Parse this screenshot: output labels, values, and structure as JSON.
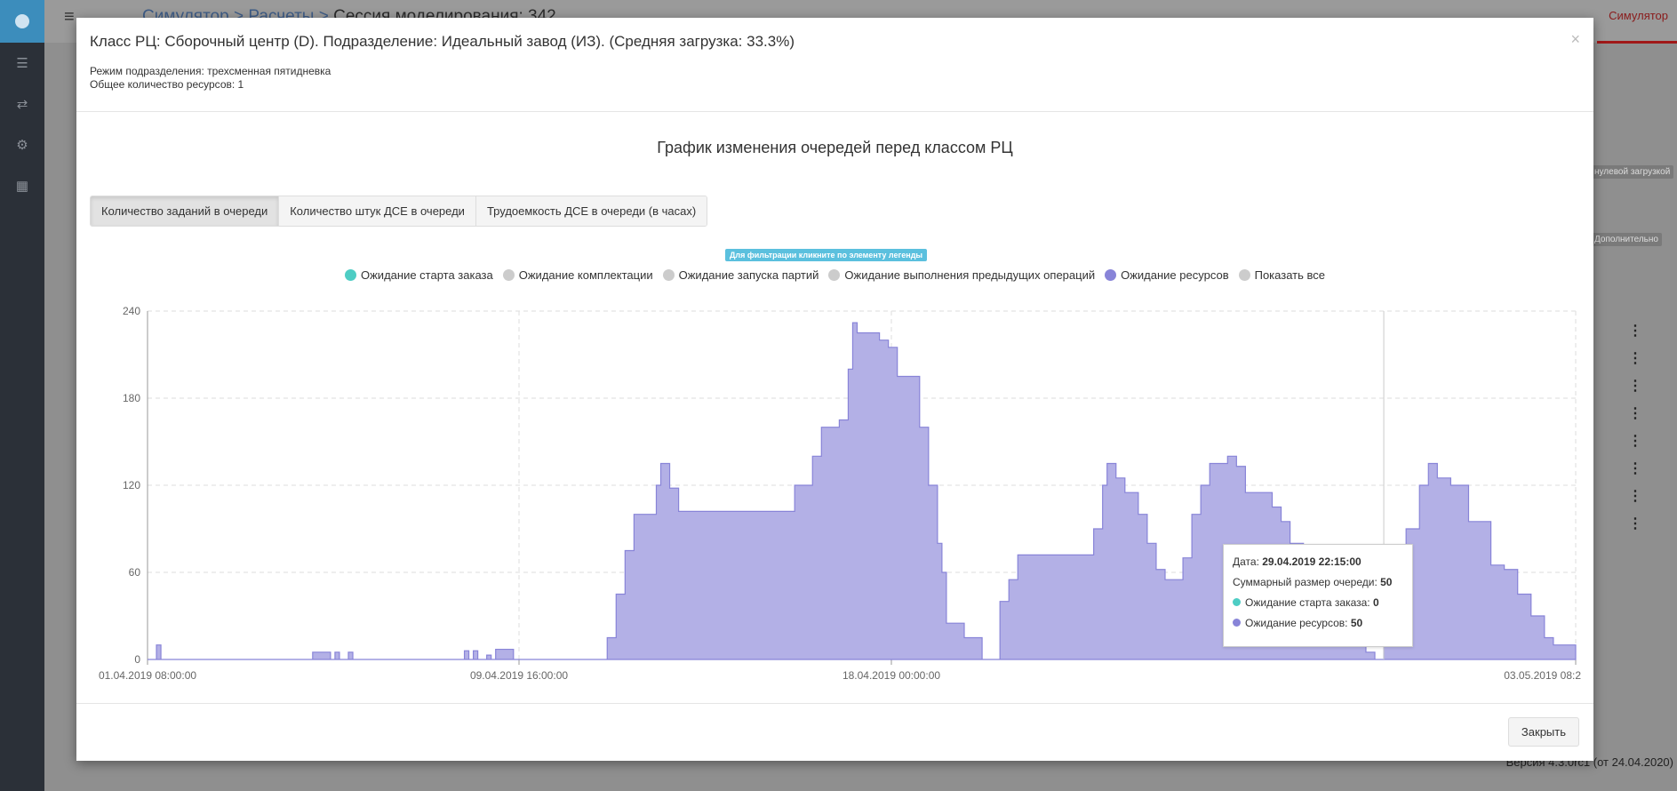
{
  "app": {
    "breadcrumb": [
      "Симулятор",
      "Расчеты"
    ],
    "breadcrumb_current": "Сессия моделирования: 342",
    "user_menu": "Симулятор",
    "version": "Версия 4.3.0rc1 (от 24.04.2020)",
    "side_buttons": [
      "Дополнительно",
      "нулевой загрузкой"
    ]
  },
  "modal": {
    "title": "Класс РЦ: Сборочный центр (D). Подразделение: Идеальный завод (ИЗ). (Средняя загрузка: 33.3%)",
    "mode_line": "Режим подразделения: трехсменная пятидневка",
    "resources_line": "Общее количество ресурсов: 1",
    "close_x": "×",
    "close_button": "Закрыть"
  },
  "tabs": [
    {
      "label": "Количество заданий в очереди",
      "active": true
    },
    {
      "label": "Количество штук ДСЕ в очереди",
      "active": false
    },
    {
      "label": "Трудоемкость ДСЕ в очереди (в часах)",
      "active": false
    }
  ],
  "hint": "Для фильтрации кликните по элементу легенды",
  "legend": [
    {
      "label": "Ожидание старта заказа",
      "color": "#4ecdc4",
      "active": true
    },
    {
      "label": "Ожидание комплектации",
      "color": "#cccccc",
      "active": false
    },
    {
      "label": "Ожидание запуска партий",
      "color": "#cccccc",
      "active": false
    },
    {
      "label": "Ожидание выполнения предыдущих операций",
      "color": "#cccccc",
      "active": false
    },
    {
      "label": "Ожидание ресурсов",
      "color": "#8884d8",
      "active": true
    },
    {
      "label": "Показать все",
      "color": "#cccccc",
      "active": false
    }
  ],
  "tooltip": {
    "date_label": "Дата:",
    "date_value": "29.04.2019 22:15:00",
    "total_label": "Суммарный размер очереди:",
    "total_value": "50",
    "s1_label": "Ожидание старта заказа:",
    "s1_value": "0",
    "s2_label": "Ожидание ресурсов:",
    "s2_value": "50"
  },
  "chart_data": {
    "type": "area",
    "title": "График изменения очередей перед классом РЦ",
    "x_tick_labels": [
      "01.04.2019 08:00:00",
      "09.04.2019 16:00:00",
      "18.04.2019 00:00:00",
      "03.05.2019 08:2"
    ],
    "x_domain_days": [
      0,
      32.0
    ],
    "ylim": [
      0,
      240
    ],
    "y_ticks": [
      0,
      60,
      120,
      180,
      240
    ],
    "grid": true,
    "fill_color": "#b3b0e6",
    "line_color": "#8884d8",
    "series": [
      {
        "name": "Ожидание ресурсов",
        "points": [
          [
            0.0,
            0
          ],
          [
            0.2,
            10
          ],
          [
            0.3,
            0
          ],
          [
            3.6,
            0
          ],
          [
            3.7,
            5
          ],
          [
            4.0,
            5
          ],
          [
            4.1,
            0
          ],
          [
            4.2,
            5
          ],
          [
            4.3,
            0
          ],
          [
            4.5,
            5
          ],
          [
            4.6,
            0
          ],
          [
            7.0,
            0
          ],
          [
            7.1,
            6
          ],
          [
            7.2,
            0
          ],
          [
            7.3,
            6
          ],
          [
            7.4,
            0
          ],
          [
            7.6,
            3
          ],
          [
            7.7,
            0
          ],
          [
            7.8,
            7
          ],
          [
            8.1,
            7
          ],
          [
            8.2,
            0
          ],
          [
            10.1,
            0
          ],
          [
            10.3,
            15
          ],
          [
            10.5,
            45
          ],
          [
            10.7,
            75
          ],
          [
            10.9,
            100
          ],
          [
            11.2,
            100
          ],
          [
            11.4,
            120
          ],
          [
            11.5,
            135
          ],
          [
            11.7,
            118
          ],
          [
            11.9,
            102
          ],
          [
            14.1,
            102
          ],
          [
            14.5,
            120
          ],
          [
            14.9,
            140
          ],
          [
            15.1,
            160
          ],
          [
            15.5,
            165
          ],
          [
            15.7,
            200
          ],
          [
            15.8,
            232
          ],
          [
            15.9,
            225
          ],
          [
            16.2,
            225
          ],
          [
            16.4,
            220
          ],
          [
            16.6,
            215
          ],
          [
            16.8,
            195
          ],
          [
            17.1,
            195
          ],
          [
            17.3,
            160
          ],
          [
            17.5,
            120
          ],
          [
            17.7,
            80
          ],
          [
            17.8,
            60
          ],
          [
            17.9,
            25
          ],
          [
            18.2,
            25
          ],
          [
            18.3,
            15
          ],
          [
            18.6,
            15
          ],
          [
            18.7,
            0
          ],
          [
            18.9,
            0
          ],
          [
            19.1,
            40
          ],
          [
            19.3,
            55
          ],
          [
            19.5,
            72
          ],
          [
            21.0,
            72
          ],
          [
            21.2,
            90
          ],
          [
            21.4,
            120
          ],
          [
            21.5,
            135
          ],
          [
            21.7,
            125
          ],
          [
            21.9,
            115
          ],
          [
            22.2,
            100
          ],
          [
            22.4,
            80
          ],
          [
            22.6,
            62
          ],
          [
            22.8,
            55
          ],
          [
            23.0,
            55
          ],
          [
            23.2,
            70
          ],
          [
            23.4,
            100
          ],
          [
            23.6,
            120
          ],
          [
            23.8,
            135
          ],
          [
            24.2,
            140
          ],
          [
            24.4,
            133
          ],
          [
            24.6,
            115
          ],
          [
            24.9,
            115
          ],
          [
            25.2,
            105
          ],
          [
            25.4,
            95
          ],
          [
            25.6,
            80
          ],
          [
            25.9,
            70
          ],
          [
            26.2,
            50
          ],
          [
            26.8,
            40
          ],
          [
            27.3,
            5
          ],
          [
            27.5,
            0
          ],
          [
            27.7,
            50
          ],
          [
            28.0,
            60
          ],
          [
            28.2,
            90
          ],
          [
            28.5,
            120
          ],
          [
            28.7,
            135
          ],
          [
            28.9,
            125
          ],
          [
            29.2,
            120
          ],
          [
            29.6,
            95
          ],
          [
            30.1,
            65
          ],
          [
            30.4,
            62
          ],
          [
            30.7,
            45
          ],
          [
            31.0,
            30
          ],
          [
            31.3,
            15
          ],
          [
            31.5,
            10
          ],
          [
            32.0,
            10
          ]
        ]
      }
    ]
  }
}
